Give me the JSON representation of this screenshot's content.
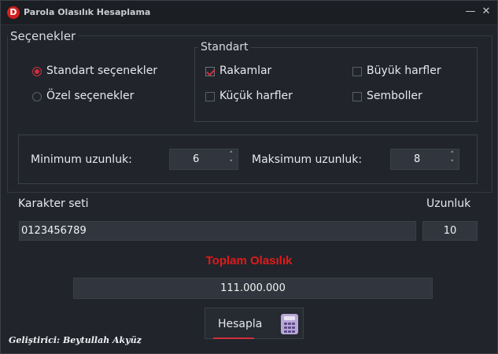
{
  "window": {
    "title": "Parola Olasılık Hesaplama",
    "icon_letter": "D",
    "minimize": "—",
    "close": "✕"
  },
  "options": {
    "group_title": "Seçenekler",
    "standard_option": "Standart seçenekler",
    "custom_option": "Özel seçenekler",
    "selected": "standard"
  },
  "standard": {
    "group_title": "Standart",
    "digits": {
      "label": "Rakamlar",
      "checked": true
    },
    "uppercase": {
      "label": "Büyük harfler",
      "checked": false
    },
    "lowercase": {
      "label": "Küçük harfler",
      "checked": false
    },
    "symbols": {
      "label": "Semboller",
      "checked": false
    }
  },
  "length": {
    "min_label": "Minimum uzunluk:",
    "min_value": "6",
    "max_label": "Maksimum uzunluk:",
    "max_value": "8"
  },
  "charset": {
    "label": "Karakter seti",
    "value": "0123456789",
    "length_label": "Uzunluk",
    "length_value": "10"
  },
  "result": {
    "title": "Toplam Olasılık",
    "value": "111.000.000"
  },
  "calc_button": {
    "label": "Hesapla",
    "icon": "calculator-icon"
  },
  "footer": {
    "developer": "Geliştirici: Beytullah Akyüz"
  },
  "colors": {
    "accent": "#d22e3e",
    "total_title": "#e01a1a",
    "background": "#21252b",
    "field": "#31363e"
  }
}
